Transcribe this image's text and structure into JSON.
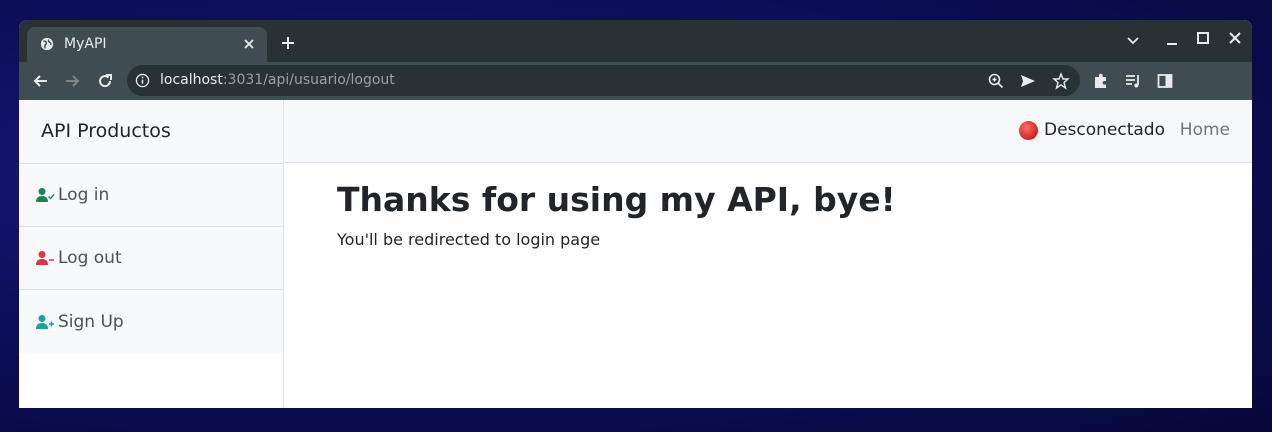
{
  "browser": {
    "tab_title": "MyAPI",
    "url_host": "localhost",
    "url_path": ":3031/api/usuario/logout"
  },
  "sidebar": {
    "brand": "API Productos",
    "items": [
      {
        "label": "Log in",
        "icon": "user-check-icon",
        "color": "#198754"
      },
      {
        "label": "Log out",
        "icon": "user-minus-icon",
        "color": "#dc3545"
      },
      {
        "label": "Sign Up",
        "icon": "user-plus-icon",
        "color": "#20a0a0"
      }
    ]
  },
  "navbar": {
    "status_text": "Desconectado",
    "status_color": "#d32020",
    "home_label": "Home"
  },
  "main": {
    "heading": "Thanks for using my API, bye!",
    "message": "You'll be redirected to login page"
  }
}
